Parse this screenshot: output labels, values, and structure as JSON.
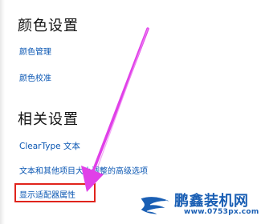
{
  "color_settings": {
    "heading": "颜色设置",
    "links": [
      "颜色管理",
      "颜色校准"
    ]
  },
  "related_settings": {
    "heading": "相关设置",
    "links": [
      "ClearType 文本",
      "文本和其他项目大小调整的高级选项",
      "显示适配器属性"
    ]
  },
  "annotation": {
    "arrow_color": "#e040e8",
    "highlight_color": "#e0241c",
    "highlighted_link": "显示适配器属性"
  },
  "watermark": {
    "title": "鹏鑫装机网",
    "url": "www.0753px.com",
    "logo_icon": "bird-logo-icon",
    "color": "#1a5fb4"
  }
}
